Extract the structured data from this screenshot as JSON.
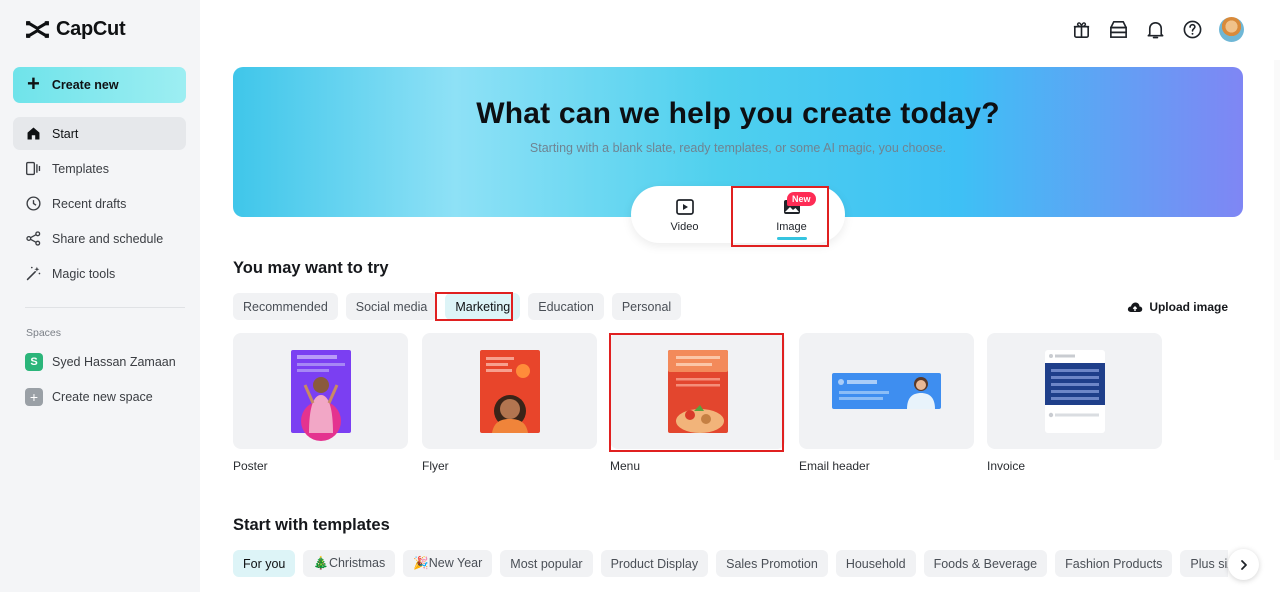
{
  "app": {
    "name": "CapCut"
  },
  "sidebar": {
    "create_label": "Create new",
    "items": [
      {
        "label": "Start",
        "icon": "home-icon"
      },
      {
        "label": "Templates",
        "icon": "templates-icon"
      },
      {
        "label": "Recent drafts",
        "icon": "clock-icon"
      },
      {
        "label": "Share and schedule",
        "icon": "share-icon"
      },
      {
        "label": "Magic tools",
        "icon": "magic-wand-icon"
      }
    ],
    "spaces_title": "Spaces",
    "space_user": {
      "initial": "S",
      "name": "Syed Hassan Zamaan"
    },
    "create_space": "Create new space"
  },
  "hero": {
    "title": "What can we help you create today?",
    "subtitle": "Starting with a blank slate, ready templates, or some AI magic, you choose.",
    "modes": [
      {
        "label": "Video"
      },
      {
        "label": "Image"
      }
    ],
    "new_badge": "New"
  },
  "try_section": {
    "title": "You may want to try",
    "chips": [
      "Recommended",
      "Social media",
      "Marketing",
      "Education",
      "Personal"
    ],
    "active_chip": "Marketing",
    "upload_label": "Upload image",
    "cards": [
      "Poster",
      "Flyer",
      "Menu",
      "Email header",
      "Invoice"
    ]
  },
  "templates_section": {
    "title": "Start with templates",
    "chips": [
      "For you",
      "🎄Christmas",
      "🎉New Year",
      "Most popular",
      "Product Display",
      "Sales Promotion",
      "Household",
      "Foods & Beverage",
      "Fashion Products",
      "Plus size cloth"
    ]
  },
  "colors": {
    "accent": "#35c4e0",
    "highlight_box": "#e02020",
    "new_badge": "#fe2c55"
  }
}
